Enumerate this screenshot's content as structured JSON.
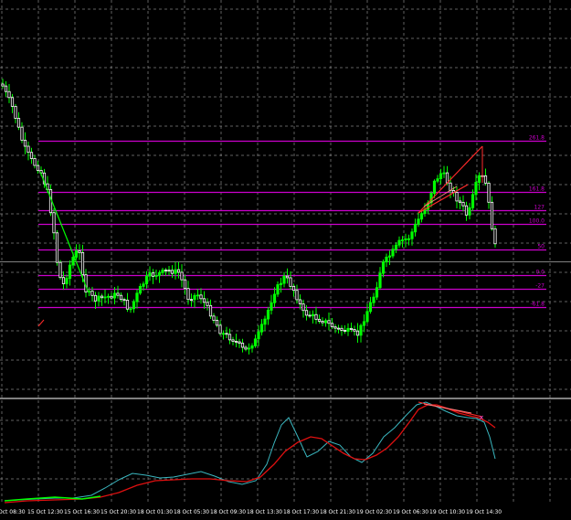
{
  "colors": {
    "background": "#000000",
    "grid": "#b0b0b0",
    "candle_up": "#00ff00",
    "candle_down": "#ffffff",
    "level_line": "#cc00cc",
    "level_label": "#cc00cc",
    "price_line": "#808080",
    "trend_line": "#00ff00",
    "fib_line": "#ff2a2a",
    "fib_line2": "#ff8080",
    "osc_fast": "#3ab7c0",
    "osc_slow": "#e01010",
    "panel_separator": "#ffffff",
    "axis_text": "#ffffff"
  },
  "levels": [
    {
      "label": "261.8",
      "price": 261.8
    },
    {
      "label": "161.8",
      "price": 161.8
    },
    {
      "label": "127",
      "price": 127
    },
    {
      "label": "100.0",
      "price": 100
    },
    {
      "label": "50",
      "price": 50
    },
    {
      "label": "0.0",
      "price": 0
    },
    {
      "label": "-27",
      "price": -27
    },
    {
      "label": "-61.8",
      "price": -61.8
    }
  ],
  "time_labels": [
    "Oct 08:30",
    "15 Oct 12:30",
    "15 Oct 16:30",
    "15 Oct 20:30",
    "18 Oct 01:30",
    "18 Oct 05:30",
    "18 Oct 09:30",
    "18 Oct 13:30",
    "18 Oct 17:30",
    "18 Oct 21:30",
    "19 Oct 02:30",
    "19 Oct 06:30",
    "19 Oct 10:30",
    "19 Oct 14:30"
  ]
}
